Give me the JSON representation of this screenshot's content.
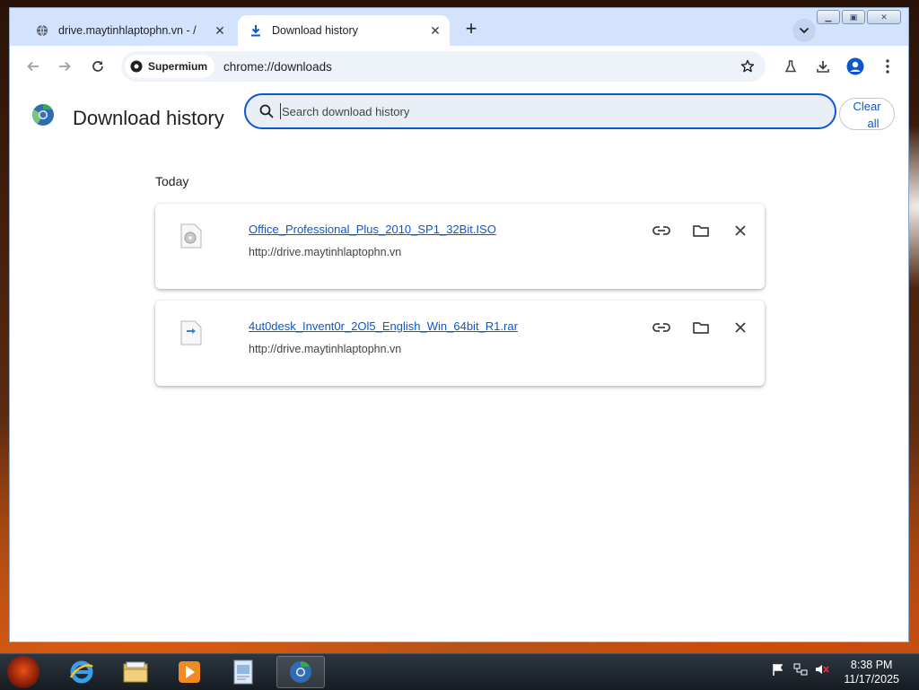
{
  "browser": {
    "tabs": [
      {
        "label": "drive.maytinhlaptophn.vn - /",
        "icon": "globe-icon",
        "close": "✕"
      },
      {
        "label": "Download history",
        "icon": "download-icon",
        "close": "✕"
      }
    ],
    "new_tab": "+",
    "address": {
      "chip_label": "Supermium",
      "url": "chrome://downloads"
    }
  },
  "page": {
    "title": "Download history",
    "search_placeholder": "Search download history",
    "clear_all_line1": "Clear",
    "clear_all_line2": "all",
    "section_date": "Today",
    "downloads": [
      {
        "file_name": "Office_Professional_Plus_2010_SP1_32Bit.ISO",
        "source": "http://drive.maytinhlaptophn.vn",
        "icon": "disc-file-icon"
      },
      {
        "file_name": "4ut0desk_Invent0r_2Ol5_English_Win_64bit_R1.rar",
        "source": "http://drive.maytinhlaptophn.vn",
        "icon": "archive-file-icon"
      }
    ]
  },
  "taskbar": {
    "time": "8:38 PM",
    "date": "11/17/2025"
  },
  "colors": {
    "accent": "#0b57d0",
    "titlebar": "#d3e3fd"
  }
}
